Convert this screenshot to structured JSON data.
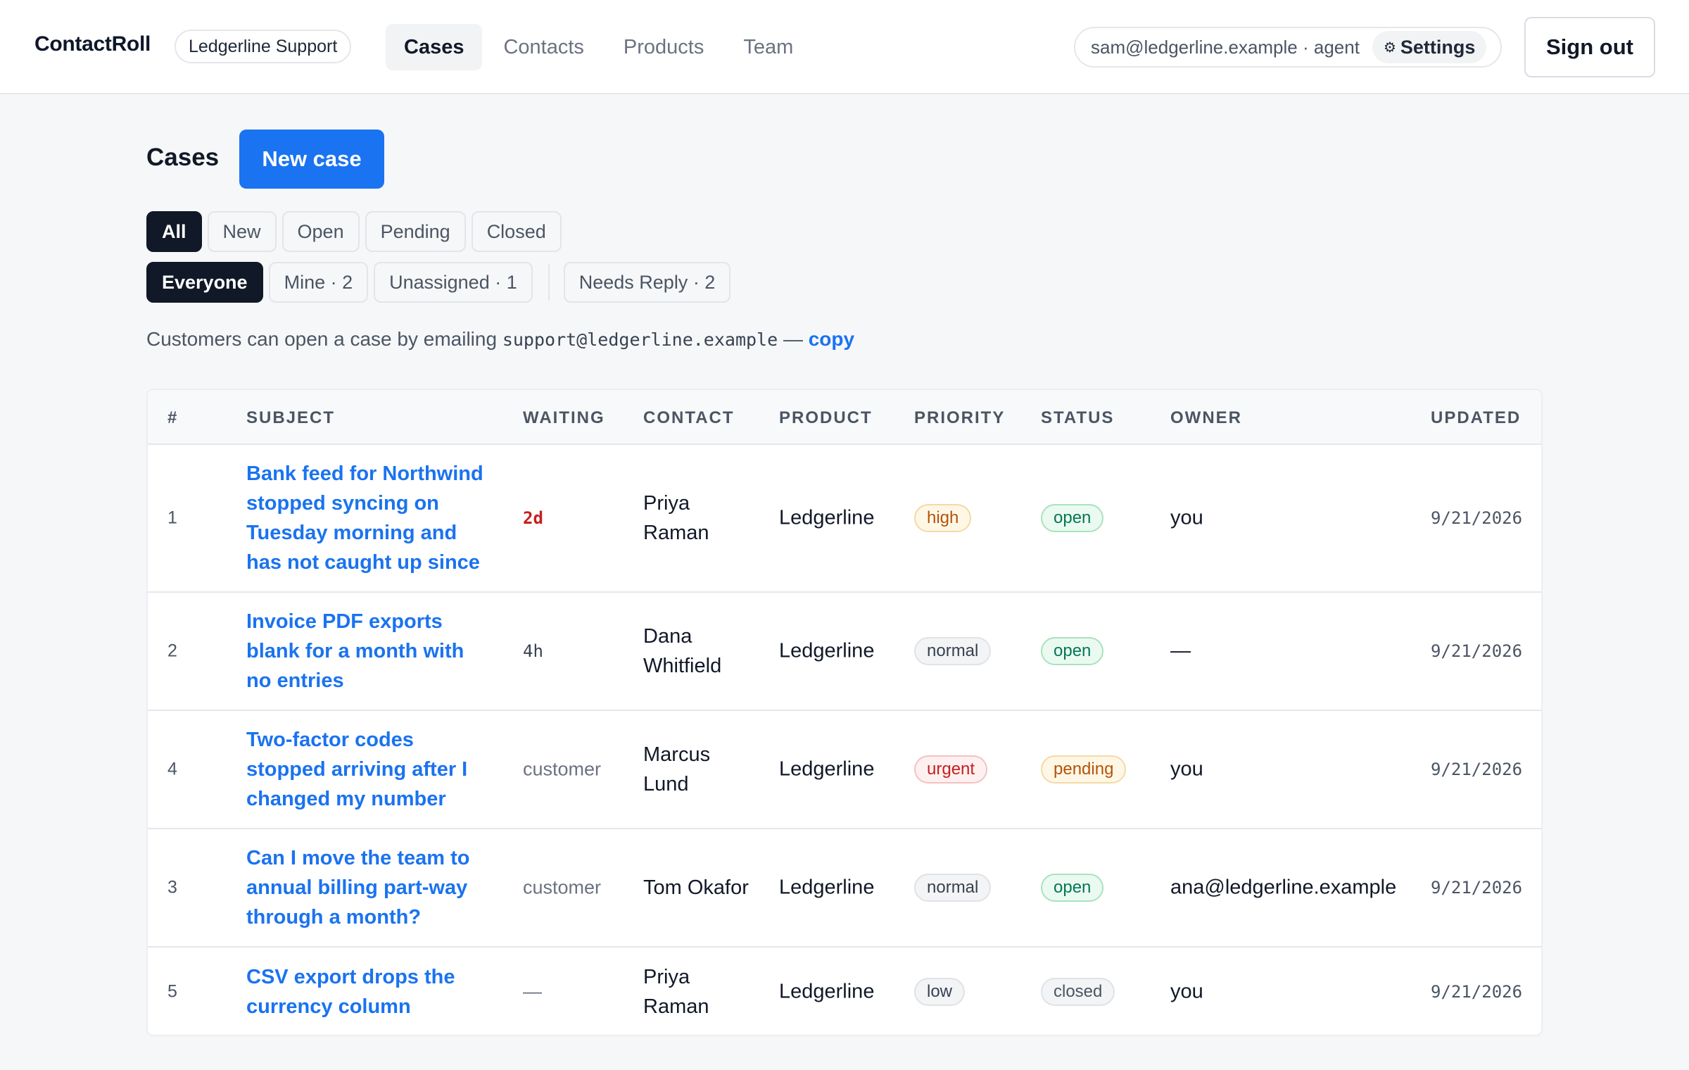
{
  "app": {
    "brand": "ContactRoll",
    "workspace": "Ledgerline Support",
    "nav": [
      {
        "label": "Cases",
        "active": true
      },
      {
        "label": "Contacts",
        "active": false
      },
      {
        "label": "Products",
        "active": false
      },
      {
        "label": "Team",
        "active": false
      }
    ],
    "account": {
      "identity": "sam@ledgerline.example · agent",
      "settings_icon": "⚙",
      "settings_label": "Settings"
    },
    "sign_out_label": "Sign out"
  },
  "page": {
    "title": "Cases",
    "new_case_label": "New case",
    "status_filters": [
      {
        "label": "All",
        "active": true
      },
      {
        "label": "New",
        "active": false
      },
      {
        "label": "Open",
        "active": false
      },
      {
        "label": "Pending",
        "active": false
      },
      {
        "label": "Closed",
        "active": false
      }
    ],
    "scope_filters": [
      {
        "label": "Everyone",
        "active": true
      },
      {
        "label": "Mine · 2",
        "active": false
      },
      {
        "label": "Unassigned · 1",
        "active": false
      }
    ],
    "reply_filter": {
      "label": "Needs Reply · 2",
      "active": false
    },
    "hint": {
      "prefix": "Customers can open a case by emailing ",
      "email": "support@ledgerline.example",
      "dash": " — ",
      "copy_label": "copy"
    }
  },
  "table": {
    "columns": {
      "num": "#",
      "subject": "SUBJECT",
      "waiting": "WAITING",
      "contact": "CONTACT",
      "product": "PRODUCT",
      "priority": "PRIORITY",
      "status": "STATUS",
      "owner": "OWNER",
      "updated": "UPDATED"
    },
    "rows": [
      {
        "num": "1",
        "subject": "Bank feed for Northwind stopped syncing on Tuesday morning and has not caught up since",
        "waiting": "2d",
        "waiting_style": "alert",
        "contact": "Priya Raman",
        "product": "Ledgerline",
        "priority": "high",
        "status": "open",
        "owner": "you",
        "updated": "9/21/2026"
      },
      {
        "num": "2",
        "subject": "Invoice PDF exports blank for a month with no entries",
        "waiting": "4h",
        "waiting_style": "mono",
        "contact": "Dana Whitfield",
        "product": "Ledgerline",
        "priority": "normal",
        "status": "open",
        "owner": "—",
        "updated": "9/21/2026"
      },
      {
        "num": "4",
        "subject": "Two-factor codes stopped arriving after I changed my number",
        "waiting": "customer",
        "waiting_style": "plain",
        "contact": "Marcus Lund",
        "product": "Ledgerline",
        "priority": "urgent",
        "status": "pending",
        "owner": "you",
        "updated": "9/21/2026"
      },
      {
        "num": "3",
        "subject": "Can I move the team to annual billing part-way through a month?",
        "waiting": "customer",
        "waiting_style": "plain",
        "contact": "Tom Okafor",
        "product": "Ledgerline",
        "priority": "normal",
        "status": "open",
        "owner": "ana@ledgerline.example",
        "updated": "9/21/2026"
      },
      {
        "num": "5",
        "subject": "CSV export drops the currency column",
        "waiting": "—",
        "waiting_style": "plain",
        "contact": "Priya Raman",
        "product": "Ledgerline",
        "priority": "low",
        "status": "closed",
        "owner": "you",
        "updated": "9/21/2026"
      }
    ]
  }
}
